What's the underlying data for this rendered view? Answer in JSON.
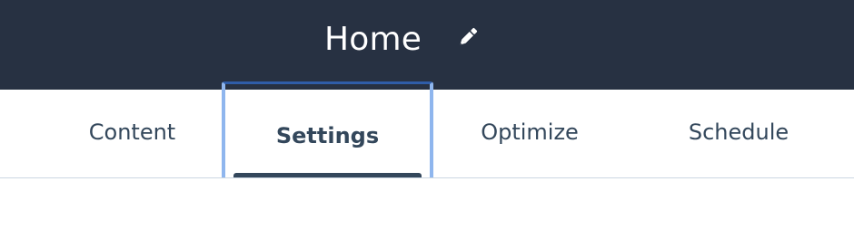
{
  "header": {
    "title": "Home",
    "edit_icon": "pencil-icon",
    "background_color": "#273142"
  },
  "tabs": [
    {
      "label": "Content",
      "selected": false
    },
    {
      "label": "Settings",
      "selected": true
    },
    {
      "label": "Optimize",
      "selected": false
    },
    {
      "label": "Schedule",
      "selected": false
    }
  ],
  "colors": {
    "text": "#33475b",
    "focus_outline": "#8fb6ee",
    "focus_top": "#2f5da8",
    "divider": "#cbd6e2"
  }
}
